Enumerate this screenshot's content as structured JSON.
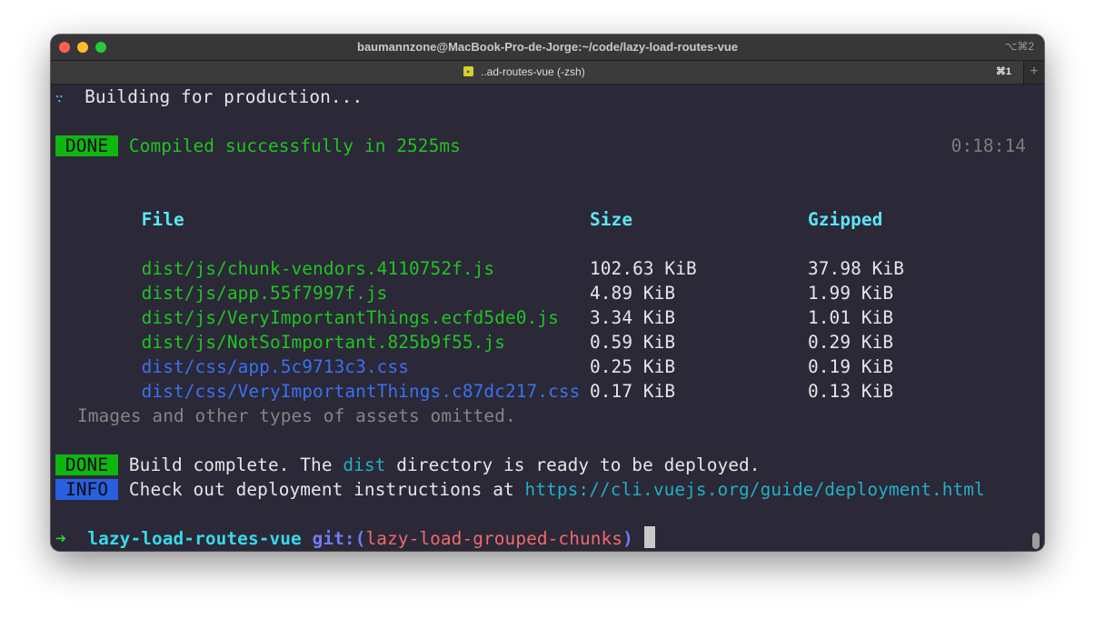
{
  "window": {
    "title": "baumannzone@MacBook-Pro-de-Jorge:~/code/lazy-load-routes-vue",
    "title_shortcut": "⌥⌘2"
  },
  "tab": {
    "icon_glyph": "▸",
    "label": "..ad-routes-vue (-zsh)",
    "shortcut": "⌘1",
    "add_label": "+"
  },
  "terminal": {
    "spinner": "∵",
    "building": "Building for production...",
    "done_badge": "DONE",
    "compiled": "Compiled successfully in 2525ms",
    "elapsed": "0:18:14",
    "headers": {
      "file": "File",
      "size": "Size",
      "gzipped": "Gzipped"
    },
    "rows": [
      {
        "file": "dist/js/chunk-vendors.4110752f.js",
        "size": "102.63 KiB",
        "gzipped": "37.98 KiB",
        "kind": "js"
      },
      {
        "file": "dist/js/app.55f7997f.js",
        "size": "4.89 KiB",
        "gzipped": "1.99 KiB",
        "kind": "js"
      },
      {
        "file": "dist/js/VeryImportantThings.ecfd5de0.js",
        "size": "3.34 KiB",
        "gzipped": "1.01 KiB",
        "kind": "js"
      },
      {
        "file": "dist/js/NotSoImportant.825b9f55.js",
        "size": "0.59 KiB",
        "gzipped": "0.29 KiB",
        "kind": "js"
      },
      {
        "file": "dist/css/app.5c9713c3.css",
        "size": "0.25 KiB",
        "gzipped": "0.19 KiB",
        "kind": "css"
      },
      {
        "file": "dist/css/VeryImportantThings.c87dc217.css",
        "size": "0.17 KiB",
        "gzipped": "0.13 KiB",
        "kind": "css"
      }
    ],
    "omitted": "Images and other types of assets omitted.",
    "build_done_pre": "Build complete. The ",
    "build_done_dir": "dist",
    "build_done_post": " directory is ready to be deployed.",
    "info_badge": "INFO",
    "info_text": "Check out deployment instructions at ",
    "info_url": "https://cli.vuejs.org/guide/deployment.html",
    "prompt": {
      "arrow": "➜",
      "dir": "lazy-load-routes-vue",
      "git_label": "git:(",
      "branch": "lazy-load-grouped-chunks",
      "git_close": ")"
    }
  },
  "colors": {
    "background": "#2b2838",
    "done_badge": "#10b610",
    "info_badge": "#2a5fe0",
    "js_file": "#21c421",
    "css_file": "#3a72ee",
    "header": "#5be7f3"
  }
}
